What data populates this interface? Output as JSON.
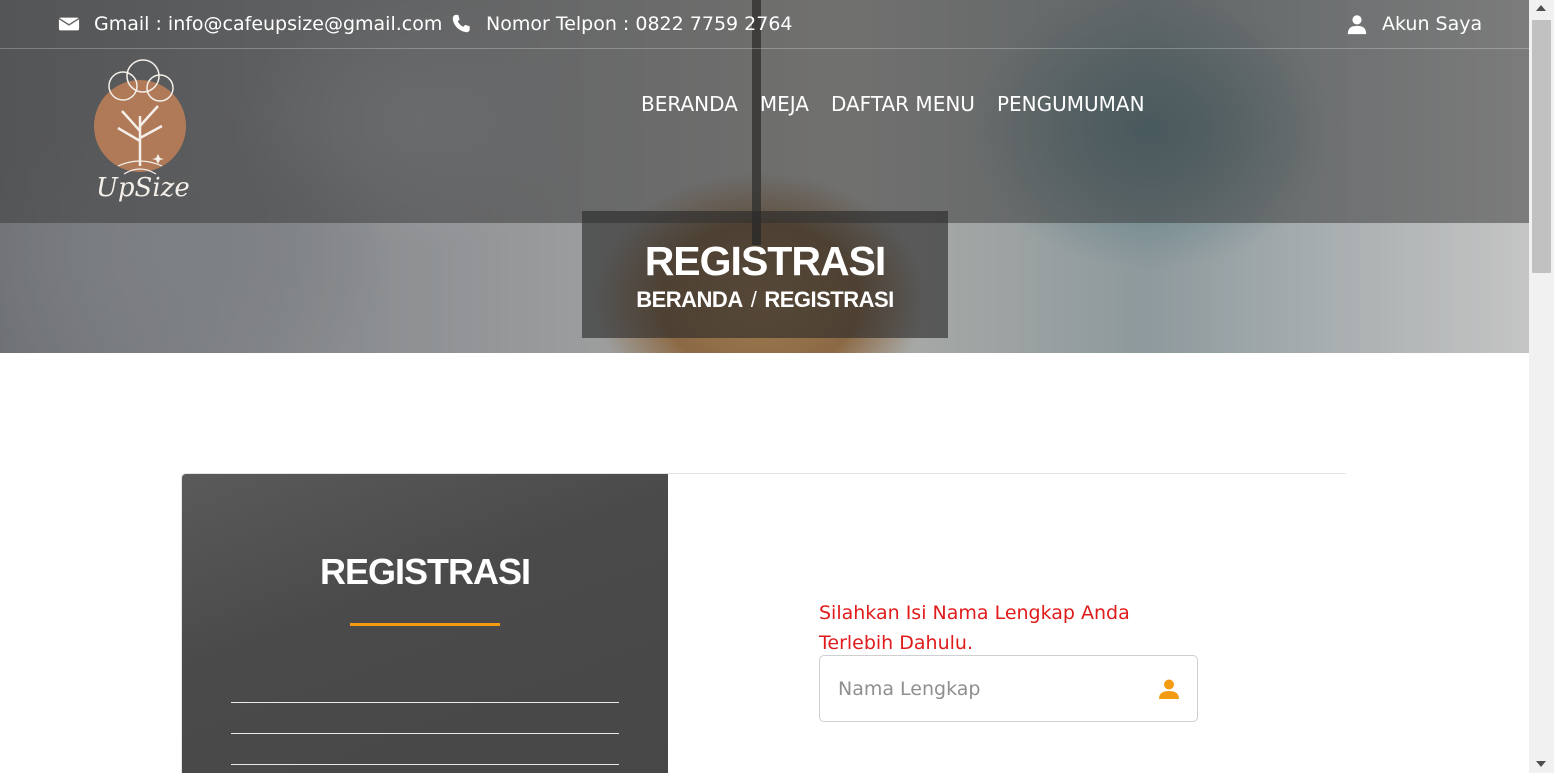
{
  "topbar": {
    "email_label": "Gmail : info@cafeupsize@gmail.com",
    "phone_label": "Nomor Telpon : 0822 7759 2764",
    "account_label": "Akun Saya",
    "email_icon": "envelope-icon",
    "phone_icon": "phone-icon",
    "account_icon": "user-icon"
  },
  "logo": {
    "text": "UpSize",
    "icon": "tree-logo-icon"
  },
  "nav": {
    "items": [
      {
        "label": "BERANDA"
      },
      {
        "label": "MEJA"
      },
      {
        "label": "DAFTAR MENU"
      },
      {
        "label": "PENGUMUMAN"
      }
    ]
  },
  "hero": {
    "title": "REGISTRASI",
    "breadcrumb": {
      "home": "BERANDA",
      "separator": "/",
      "current": "REGISTRASI"
    }
  },
  "registration": {
    "panel_title": "REGISTRASI",
    "hint": "Silahkan Isi Nama Lengkap Anda Terlebih Dahulu.",
    "name_field": {
      "placeholder": "Nama Lengkap",
      "value": "",
      "icon": "user-icon"
    }
  },
  "colors": {
    "accent": "#f39c12",
    "hint_text": "#e01b1b",
    "panel_bg": "#4a4a4a"
  }
}
